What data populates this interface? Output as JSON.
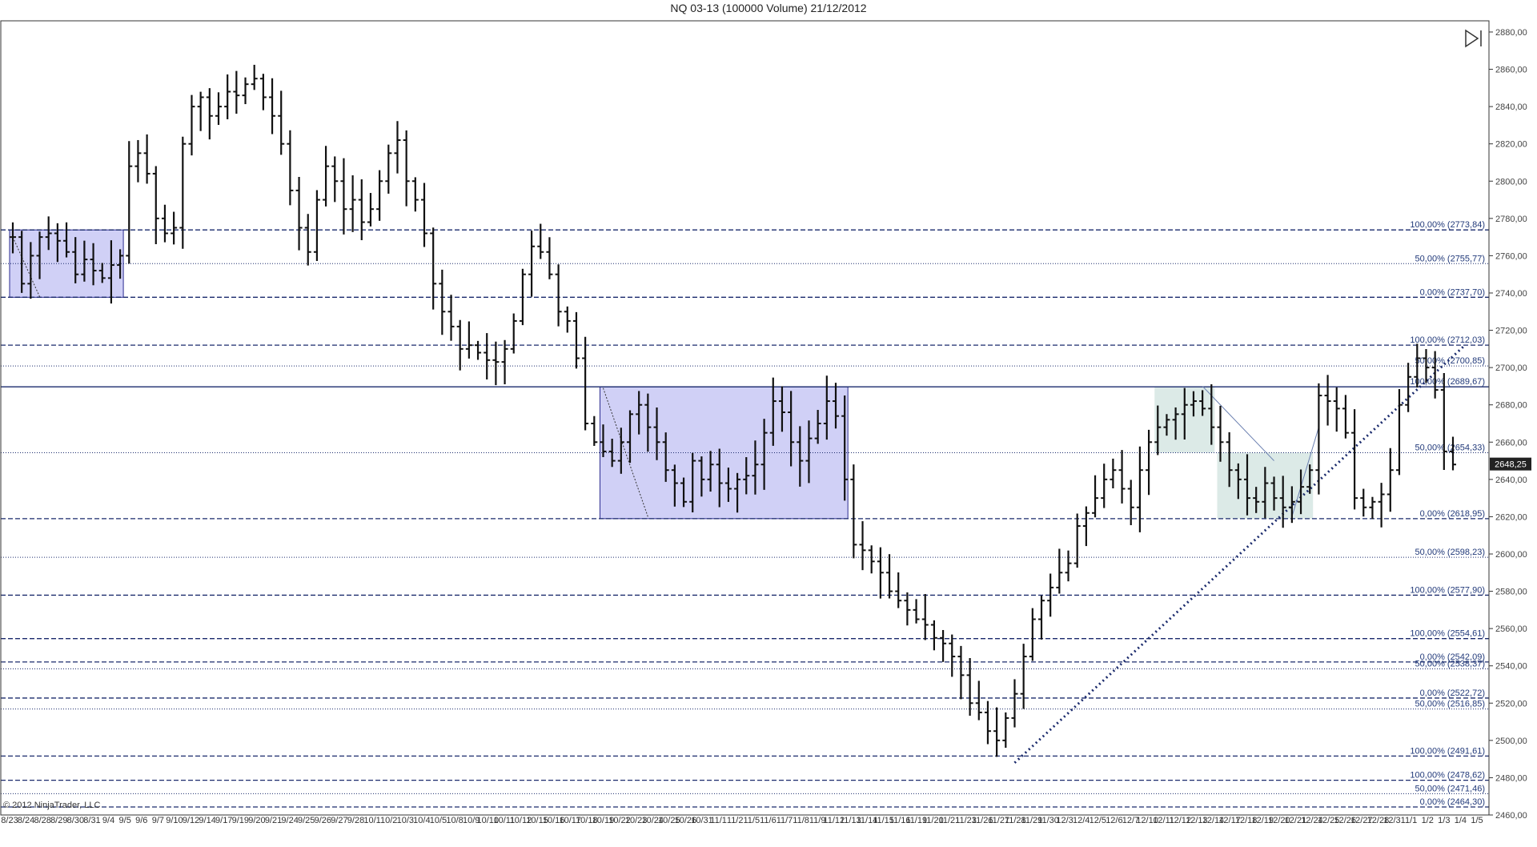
{
  "chart_data": {
    "type": "ohlc-bar",
    "title": "NQ 03-13 (100000 Volume)  21/12/2012",
    "instrument": "NQ 03-13",
    "period": "100000 Volume",
    "date": "21/12/2012",
    "copyright": "© 2012 NinjaTrader, LLC",
    "ylim": [
      2460,
      2886
    ],
    "y_ticks": [
      2880,
      2860,
      2840,
      2820,
      2800,
      2780,
      2760,
      2740,
      2720,
      2700,
      2680,
      2660,
      2640,
      2620,
      2600,
      2580,
      2560,
      2540,
      2520,
      2500,
      2480,
      2460
    ],
    "y_tick_labels": [
      "2880,00",
      "2860,00",
      "2840,00",
      "2820,00",
      "2800,00",
      "2780,00",
      "2760,00",
      "2740,00",
      "2720,00",
      "2700,00",
      "2680,00",
      "2660,00",
      "2640,00",
      "2620,00",
      "2600,00",
      "2580,00",
      "2560,00",
      "2540,00",
      "2520,00",
      "2500,00",
      "2480,00",
      "2460,00"
    ],
    "x_tick_labels": [
      "8/23",
      "8/24",
      "8/28",
      "8/29",
      "8/30",
      "8/31",
      "9/4",
      "9/5",
      "9/6",
      "9/7",
      "9/10",
      "9/12",
      "9/14",
      "9/17",
      "9/19",
      "9/20",
      "9/21",
      "9/24",
      "9/25",
      "9/26",
      "9/27",
      "9/28",
      "10/1",
      "10/2",
      "10/3",
      "10/4",
      "10/5",
      "10/8",
      "10/9",
      "10/10",
      "10/11",
      "10/12",
      "10/15",
      "10/16",
      "10/17",
      "10/18",
      "10/19",
      "10/22",
      "10/23",
      "10/24",
      "10/25",
      "10/26",
      "10/31",
      "11/1",
      "11/2",
      "11/5",
      "11/6",
      "11/7",
      "11/8",
      "11/9",
      "11/12",
      "11/13",
      "11/14",
      "11/15",
      "11/16",
      "11/19",
      "11/20",
      "11/21",
      "11/23",
      "11/26",
      "11/27",
      "11/28",
      "11/29",
      "11/30",
      "12/3",
      "12/4",
      "12/5",
      "12/6",
      "12/7",
      "12/10",
      "12/11",
      "12/12",
      "12/13",
      "12/14",
      "12/17",
      "12/18",
      "12/19",
      "12/20",
      "12/21",
      "12/24",
      "12/25",
      "12/26",
      "12/27",
      "12/28",
      "12/31",
      "1/1",
      "1/2",
      "1/3",
      "1/4",
      "1/5"
    ],
    "current_price": "2648,25",
    "current_value": 2648.25,
    "close_series": [
      2770,
      2745,
      2760,
      2770,
      2772,
      2768,
      2762,
      2750,
      2758,
      2752,
      2748,
      2755,
      2760,
      2808,
      2815,
      2804,
      2780,
      2772,
      2775,
      2820,
      2840,
      2845,
      2835,
      2840,
      2848,
      2846,
      2852,
      2855,
      2845,
      2835,
      2820,
      2795,
      2775,
      2762,
      2790,
      2808,
      2800,
      2785,
      2790,
      2778,
      2785,
      2800,
      2815,
      2822,
      2800,
      2790,
      2772,
      2745,
      2730,
      2722,
      2710,
      2712,
      2708,
      2704,
      2703,
      2710,
      2725,
      2750,
      2765,
      2762,
      2750,
      2730,
      2725,
      2705,
      2670,
      2660,
      2655,
      2650,
      2660,
      2675,
      2680,
      2668,
      2660,
      2645,
      2638,
      2628,
      2650,
      2640,
      2648,
      2638,
      2635,
      2640,
      2642,
      2648,
      2665,
      2682,
      2676,
      2660,
      2650,
      2662,
      2670,
      2682,
      2674,
      2640,
      2605,
      2602,
      2596,
      2590,
      2580,
      2575,
      2570,
      2565,
      2562,
      2555,
      2552,
      2545,
      2535,
      2520,
      2515,
      2505,
      2500,
      2512,
      2525,
      2545,
      2565,
      2575,
      2582,
      2590,
      2595,
      2615,
      2622,
      2630,
      2640,
      2645,
      2635,
      2625,
      2645,
      2660,
      2668,
      2672,
      2675,
      2680,
      2682,
      2678,
      2668,
      2660,
      2645,
      2640,
      2630,
      2628,
      2638,
      2630,
      2625,
      2628,
      2636,
      2645,
      2685,
      2682,
      2678,
      2665,
      2630,
      2625,
      2628,
      2632,
      2645,
      2680,
      2695,
      2705,
      2700,
      2688,
      2655,
      2648
    ],
    "fibonacci_levels": [
      {
        "label": "100,00% (2773,84)",
        "value": 2773.84,
        "style": "dash",
        "label_color": "#223a7a"
      },
      {
        "label": "50,00% (2755,77)",
        "value": 2755.77,
        "style": "dot",
        "label_color": "#223a7a"
      },
      {
        "label": "0,00% (2737,70)",
        "value": 2737.7,
        "style": "dash",
        "label_color": "#223a7a"
      },
      {
        "label": "100,00% (2712,03)",
        "value": 2712.03,
        "style": "dash",
        "label_color": "#223a7a"
      },
      {
        "label": "50,00% (2700,85)",
        "value": 2700.85,
        "style": "dot",
        "label_color": "#223a7a"
      },
      {
        "label": "100,00% (2689,67)",
        "value": 2689.67,
        "style": "solid",
        "label_color": "#111a40"
      },
      {
        "label": "50,00% (2654,33)",
        "value": 2654.33,
        "style": "dot",
        "label_color": "#223a7a"
      },
      {
        "label": "0,00% (2618,95)",
        "value": 2618.95,
        "style": "dash",
        "label_color": "#111a40"
      },
      {
        "label": "50,00% (2598,23)",
        "value": 2598.23,
        "style": "dot",
        "label_color": "#223a7a"
      },
      {
        "label": "100,00% (2577,90)",
        "value": 2577.9,
        "style": "dash",
        "label_color": "#223a7a"
      },
      {
        "label": "100,00% (2554,61)",
        "value": 2554.61,
        "style": "dash",
        "label_color": "#223a7a"
      },
      {
        "label": "0,00% (2542,09)",
        "value": 2542.09,
        "style": "dash",
        "label_color": "#223a7a"
      },
      {
        "label": "50,00% (2538,37)",
        "value": 2538.37,
        "style": "dot",
        "label_color": "#223a7a"
      },
      {
        "label": "0,00% (2522,72)",
        "value": 2522.72,
        "style": "dash",
        "label_color": "#223a7a"
      },
      {
        "label": "50,00% (2516,85)",
        "value": 2516.85,
        "style": "dot",
        "label_color": "#223a7a"
      },
      {
        "label": "100,00% (2491,61)",
        "value": 2491.61,
        "style": "dash",
        "label_color": "#223a7a"
      },
      {
        "label": "100,00% (2478,62)",
        "value": 2478.62,
        "style": "dash",
        "label_color": "#223a7a"
      },
      {
        "label": "50,00% (2471,46)",
        "value": 2471.46,
        "style": "dot",
        "label_color": "#223a7a"
      },
      {
        "label": "0,00% (2464,30)",
        "value": 2464.3,
        "style": "dash",
        "label_color": "#223a7a"
      }
    ],
    "colors": {
      "bars": "#111111",
      "level_line": "#1a2a6c",
      "range_box_fill": "#c8c8f5",
      "range_box_stroke": "#2a2a90",
      "flag_box_fill": "#d8e8e4",
      "trendline": "#1a2a6c",
      "price_marker": "#222222"
    },
    "grid": false
  }
}
